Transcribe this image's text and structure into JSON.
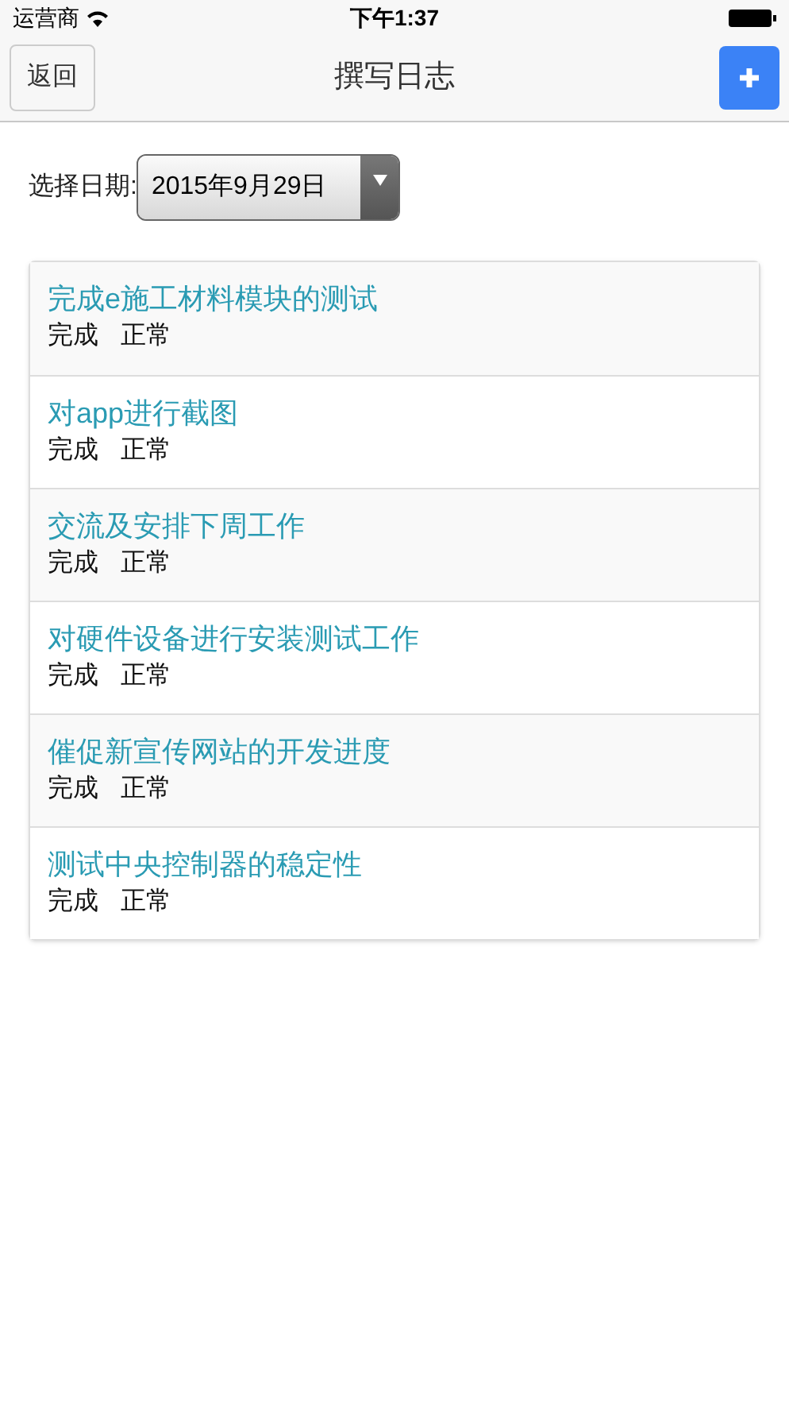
{
  "status_bar": {
    "carrier": "运营商",
    "time": "下午1:37"
  },
  "nav": {
    "back": "返回",
    "title": "撰写日志"
  },
  "date": {
    "label": "选择日期:",
    "value": "2015年9月29日"
  },
  "logs": [
    {
      "title": "完成e施工材料模块的测试",
      "progress": "完成",
      "status": "正常"
    },
    {
      "title": "对app进行截图",
      "progress": "完成",
      "status": "正常"
    },
    {
      "title": "交流及安排下周工作",
      "progress": "完成",
      "status": "正常"
    },
    {
      "title": "对硬件设备进行安装测试工作",
      "progress": "完成",
      "status": "正常"
    },
    {
      "title": "催促新宣传网站的开发进度",
      "progress": "完成",
      "status": "正常"
    },
    {
      "title": "测试中央控制器的稳定性",
      "progress": "完成",
      "status": "正常"
    }
  ]
}
